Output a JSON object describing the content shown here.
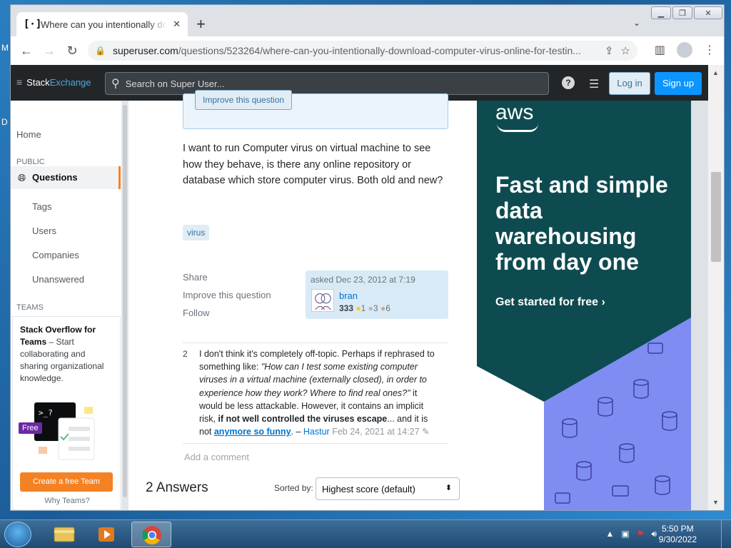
{
  "browser": {
    "tab_title": "Where can you intentionally download computer virus online for testing",
    "url_host": "superuser.com",
    "url_path": "/questions/523264/where-can-you-intentionally-download-computer-virus-online-for-testin..."
  },
  "header": {
    "logo_part1": "Stack",
    "logo_part2": "Exchange",
    "search_placeholder": "Search on Super User...",
    "login_label": "Log in",
    "signup_label": "Sign up"
  },
  "sidebar": {
    "home": "Home",
    "public_heading": "PUBLIC",
    "questions": "Questions",
    "tags": "Tags",
    "users": "Users",
    "companies": "Companies",
    "unanswered": "Unanswered",
    "teams_heading": "TEAMS",
    "teams_title": "Stack Overflow for Teams",
    "teams_text": " – Start collaborating and sharing organizational knowledge.",
    "free_badge": "Free",
    "create_team": "Create a free Team",
    "why_teams": "Why Teams?"
  },
  "question": {
    "notice_button": "Improve this question",
    "body": "I want to run Computer virus on virtual machine to see how they behave, is there any online repository or database which store computer virus. Both old and new?",
    "tag": "virus",
    "share": "Share",
    "improve": "Improve this question",
    "follow": "Follow",
    "asked": "asked Dec 23, 2012 at 7:19",
    "user": "bran",
    "rep": "333",
    "gold": "1",
    "silver": "3",
    "bronze": "6"
  },
  "comment": {
    "score": "2",
    "part1": "I don't think it's completely off-topic. Perhaps if rephrased to something like: ",
    "quote": "\"How can I test some existing computer viruses in a virtual machine (externally closed), in order to experience how they work? Where to find real ones?\"",
    "part2": " it would be less attackable. However, it contains an implicit risk, ",
    "bold": "if not well controlled the viruses escape",
    "part3": "... and it is not ",
    "link": "anymore so funny",
    "part4": ". – ",
    "user": "Hastur",
    "date": "Feb 24, 2021 at 14:27",
    "add_comment": "Add a comment"
  },
  "answers": {
    "title": "2 Answers",
    "sorted_label": "Sorted by:",
    "sort_value": "Highest score (default)"
  },
  "ad": {
    "logo": "aws",
    "headline": "Fast and simple data warehousing from day one",
    "cta": "Get started for free ›"
  },
  "taskbar": {
    "time": "5:50 PM",
    "date": "9/30/2022"
  },
  "desktop": {
    "letter1": "M",
    "letter2": "D"
  },
  "colors": {
    "accent_orange": "#f48225",
    "link_blue": "#0074cc",
    "ad_teal": "#0e4b50",
    "ad_purple": "#7f8df2"
  }
}
